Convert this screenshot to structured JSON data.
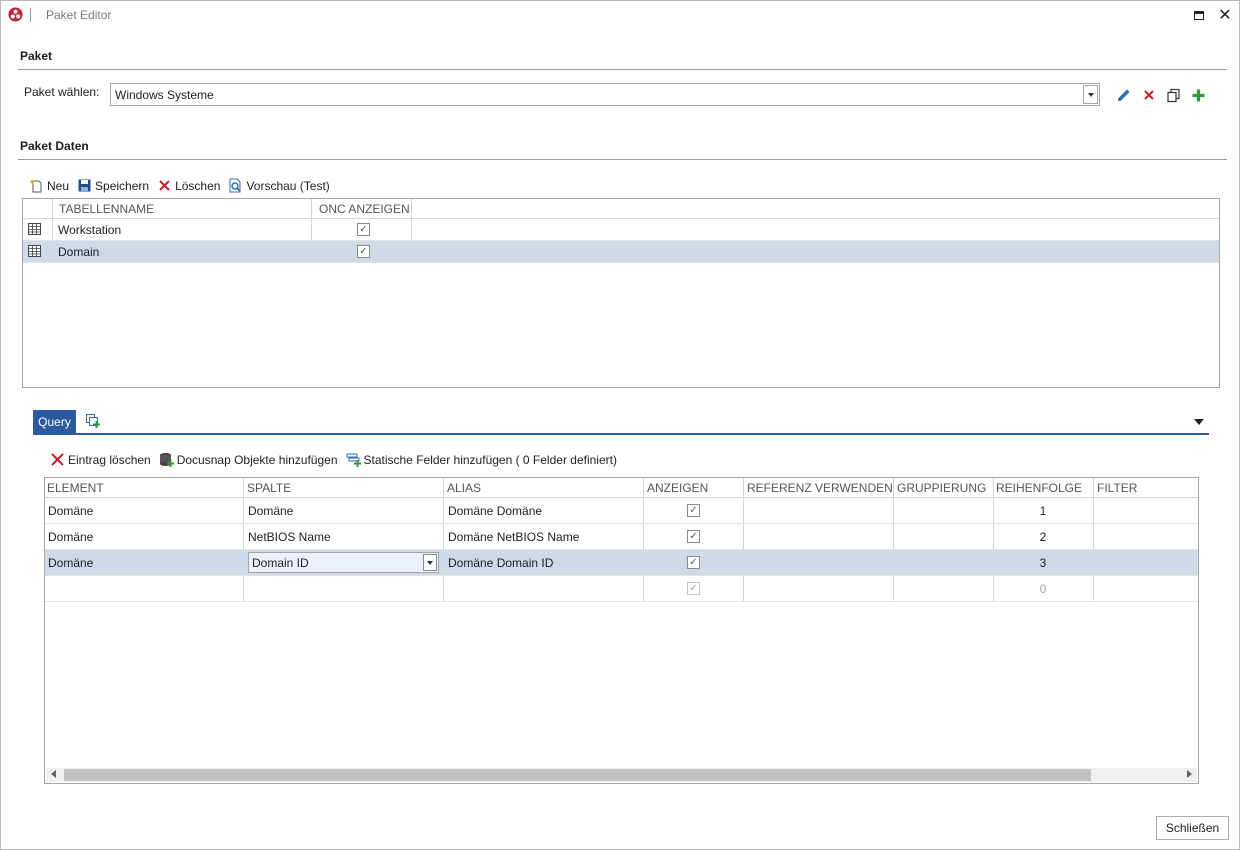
{
  "window": {
    "title": "Paket Editor",
    "accent": "#2c5aa0"
  },
  "paket": {
    "section_label": "Paket",
    "select_label": "Paket wählen:",
    "selected_value": "Windows Systeme",
    "icons": [
      "pencil-icon",
      "delete-icon",
      "copy-icon",
      "add-icon"
    ]
  },
  "paket_daten": {
    "section_label": "Paket Daten",
    "toolbar": {
      "new_label": "Neu",
      "save_label": "Speichern",
      "delete_label": "Löschen",
      "preview_label": "Vorschau (Test)"
    },
    "table": {
      "headers": [
        "TABELLENNAME",
        "ONC ANZEIGEN"
      ],
      "rows": [
        {
          "name": "Workstation",
          "onc": true,
          "selected": false
        },
        {
          "name": "Domain",
          "onc": true,
          "selected": true
        }
      ]
    }
  },
  "tabs": {
    "query_label": "Query"
  },
  "query": {
    "toolbar": {
      "delete_entry_label": "Eintrag löschen",
      "add_objects_label": "Docusnap Objekte hinzufügen",
      "add_static_label": "Statische Felder hinzufügen ( 0 Felder definiert)"
    },
    "headers": [
      "ELEMENT",
      "SPALTE",
      "ALIAS",
      "ANZEIGEN",
      "REFERENZ VERWENDEN",
      "GRUPPIERUNG",
      "REIHENFOLGE",
      "FILTER"
    ],
    "rows": [
      {
        "element": "Domäne",
        "spalte": "Domäne",
        "alias": "Domäne Domäne",
        "anzeigen": true,
        "reihenfolge": "1"
      },
      {
        "element": "Domäne",
        "spalte": "NetBIOS Name",
        "alias": "Domäne NetBIOS Name",
        "anzeigen": true,
        "reihenfolge": "2"
      },
      {
        "element": "Domäne",
        "spalte": "Domain ID",
        "alias": "Domäne Domain ID",
        "anzeigen": true,
        "reihenfolge": "3",
        "selected": true
      },
      {
        "element": "",
        "spalte": "",
        "alias": "",
        "anzeigen": true,
        "reihenfolge": "0",
        "new_row": true
      }
    ]
  },
  "footer": {
    "close_label": "Schließen"
  }
}
